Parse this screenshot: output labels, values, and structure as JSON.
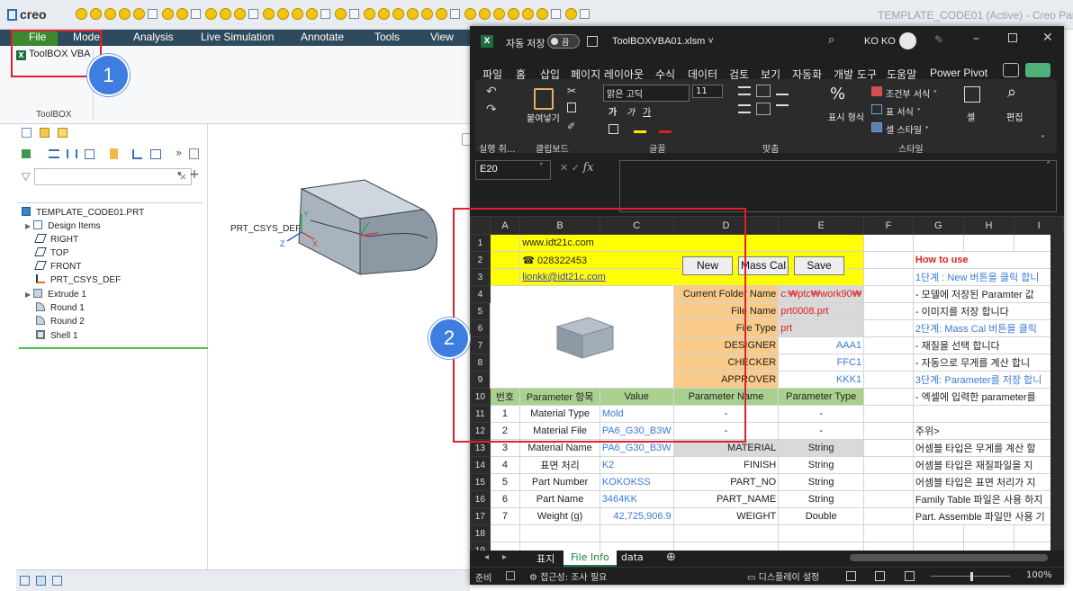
{
  "creo": {
    "logo": "creo",
    "title": "TEMPLATE_CODE01 (Active) - Creo Paran",
    "menu": [
      "File",
      "Model",
      "Analysis",
      "Live Simulation",
      "Annotate",
      "Tools",
      "View"
    ],
    "ribbon_button": "ToolBOX VBA",
    "ribbon_group": "ToolBOX",
    "tree": {
      "root": "TEMPLATE_CODE01.PRT",
      "items": [
        "Design Items",
        "RIGHT",
        "TOP",
        "FRONT",
        "PRT_CSYS_DEF",
        "Extrude 1",
        "Round 1",
        "Round 2",
        "Shell 1"
      ]
    },
    "csys_label": "PRT_CSYS_DEF",
    "axis_x": "X",
    "axis_y": "Y",
    "axis_z": "Z"
  },
  "annotations": {
    "one": "1",
    "two": "2"
  },
  "excel": {
    "autosave_label": "자동 저장",
    "autosave_state": "끔",
    "filename": "ToolBOXVBA01.xlsm ˅",
    "user": "KO KO",
    "tabs": [
      "파일",
      "홈",
      "삽입",
      "페이지 레이아웃",
      "수식",
      "데이터",
      "검토",
      "보기",
      "자동화",
      "개발 도구",
      "도움말",
      "Power Pivot"
    ],
    "ribbon": {
      "paste": "붙여넣기",
      "font_name": "맑은 고딕",
      "font_size": "11",
      "number_format": "표시 형식",
      "cond_format": "조건부 서식 ˅",
      "table_format": "표 서식 ˅",
      "cell_style": "셀 스타일 ˅",
      "cells": "셀",
      "edit": "편집",
      "groups": [
        "실행 취...",
        "클립보드",
        "글꼴",
        "맞춤",
        "스타일"
      ]
    },
    "namebox": "E20",
    "fx": "fx",
    "columns": [
      "A",
      "B",
      "C",
      "D",
      "E",
      "F",
      "G",
      "H",
      "I"
    ],
    "row_numbers": [
      "1",
      "2",
      "3",
      "4",
      "5",
      "6",
      "7",
      "8",
      "9",
      "10",
      "11",
      "12",
      "13",
      "14",
      "15",
      "16",
      "17",
      "18",
      "19"
    ],
    "header_block": {
      "website": "www.idt21c.com",
      "phone": "☎ 028322453",
      "email": "lionkk@idt21c.com"
    },
    "buttons": {
      "new": "New",
      "mass": "Mass Cal",
      "save": "Save"
    },
    "info": [
      {
        "label": "Current Folder Name",
        "value": "c:₩ptc₩work90₩"
      },
      {
        "label": "File Name",
        "value": "prt0008.prt"
      },
      {
        "label": "File Type",
        "value": "prt"
      },
      {
        "label": "DESIGNER",
        "value": "AAA1"
      },
      {
        "label": "CHECKER",
        "value": "FFC1"
      },
      {
        "label": "APPROVER",
        "value": "KKK1"
      }
    ],
    "param_header": [
      "번호",
      "Parameter 항목",
      "Value",
      "Parameter Name",
      "Parameter Type"
    ],
    "params": [
      [
        "1",
        "Material Type",
        "Mold",
        "-",
        "-"
      ],
      [
        "2",
        "Material File",
        "PA6_G30_B3W",
        "-",
        "-"
      ],
      [
        "3",
        "Material Name",
        "PA6_G30_B3W",
        "MATERIAL",
        "String"
      ],
      [
        "4",
        "표면 처리",
        "K2",
        "FINISH",
        "String"
      ],
      [
        "5",
        "Part Number",
        "KOKOKSS",
        "PART_NO",
        "String"
      ],
      [
        "6",
        "Part Name",
        "3464KK",
        "PART_NAME",
        "String"
      ],
      [
        "7",
        "Weight (g)",
        "42,725,906.9",
        "WEIGHT",
        "Double"
      ]
    ],
    "howto": [
      "How to use",
      "1단계 : New 버튼을 클릭 합니",
      " - 모델에 저장된 Paramter 값",
      " - 이미지를 저장 합니다",
      "2단계: Mass Cal 버튼을 클릭",
      " - 재질을 선택 합니다",
      " - 자동으로 무게를 계산 합니",
      "3단계: Parameter를 저장 합니",
      " - 엑셀에 입력한 parameter를",
      "",
      "주위>",
      "어셈블 타입은 무게를 계산 할",
      "어셈블 타입은 재질파일을 지",
      "어셈블 타입은 표면 처리가 지",
      "Family Table 파일은 사용 하지",
      "Part. Assemble 파일만 사용 기"
    ],
    "sheets": [
      "표지",
      "File Info",
      "data"
    ],
    "status": {
      "ready": "준비",
      "accessibility": "접근성: 조사 필요",
      "display": "디스플레이 설정",
      "zoom": "100%"
    },
    "colors": {
      "accent": "#4fb07a",
      "link": "#3b7ad6",
      "red": "#e02020",
      "yellow": "#ffff00",
      "orange": "#f8cb8a",
      "green": "#a9d08e"
    }
  }
}
